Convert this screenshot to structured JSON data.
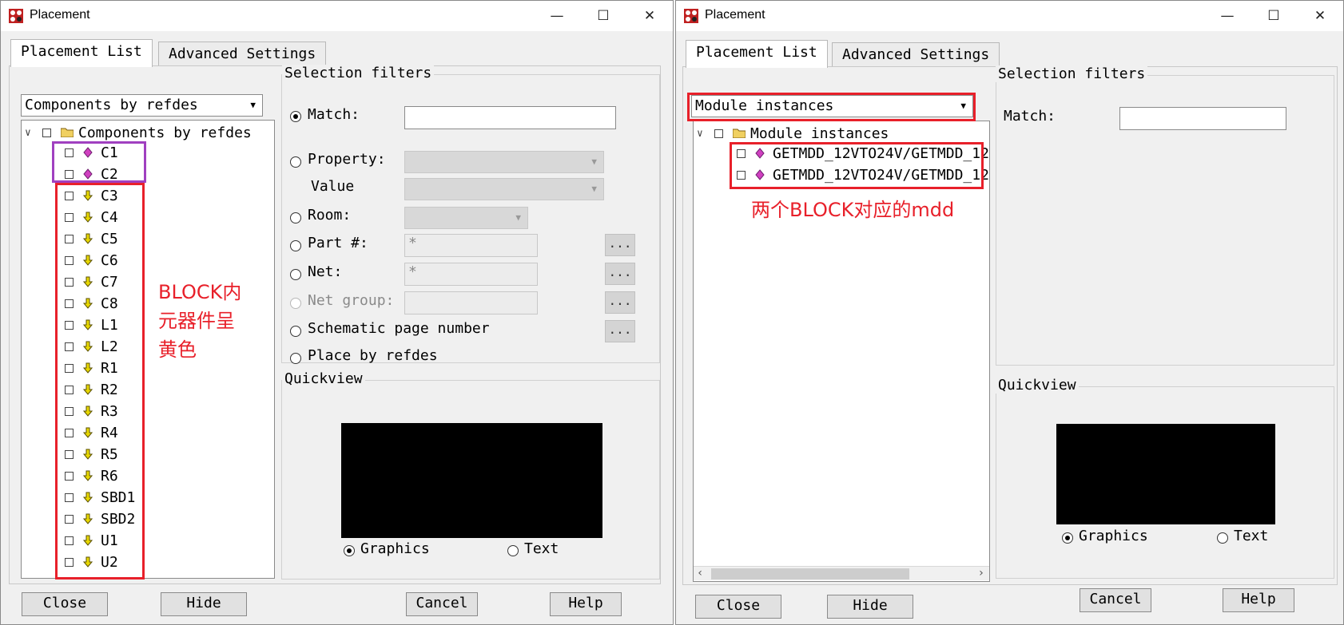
{
  "left_window": {
    "title": "Placement",
    "tabs": [
      {
        "label": "Placement List"
      },
      {
        "label": "Advanced Settings"
      }
    ],
    "dropdown_value": "Components by refdes",
    "tree_root": "Components by refdes",
    "components": [
      "C1",
      "C2",
      "C3",
      "C4",
      "C5",
      "C6",
      "C7",
      "C8",
      "L1",
      "L2",
      "R1",
      "R2",
      "R3",
      "R4",
      "R5",
      "R6",
      "SBD1",
      "SBD2",
      "U1",
      "U2"
    ],
    "selection_filters": {
      "label": "Selection filters",
      "match": "Match:",
      "property": "Property:",
      "value": "Value",
      "room": "Room:",
      "part": "Part #:",
      "part_value": "*",
      "net": "Net:",
      "net_value": "*",
      "net_group": "Net group:",
      "schematic_page": "Schematic page number",
      "place_by_refdes": "Place by refdes",
      "ellipsis": "..."
    },
    "quickview": {
      "label": "Quickview",
      "graphics": "Graphics",
      "text": "Text"
    },
    "buttons": {
      "close": "Close",
      "hide": "Hide",
      "cancel": "Cancel",
      "help": "Help"
    },
    "annotation": [
      "BLOCK内",
      "元器件呈",
      "黄色"
    ]
  },
  "right_window": {
    "title": "Placement",
    "tabs": [
      {
        "label": "Placement List"
      },
      {
        "label": "Advanced Settings"
      }
    ],
    "dropdown_value": "Module instances",
    "tree_root": "Module instances",
    "instances": [
      "GETMDD_12VTO24V/GETMDD_12",
      "GETMDD_12VTO24V/GETMDD_12"
    ],
    "selection_filters": {
      "label": "Selection filters",
      "match": "Match:"
    },
    "quickview": {
      "label": "Quickview",
      "graphics": "Graphics",
      "text": "Text"
    },
    "buttons": {
      "close": "Close",
      "hide": "Hide",
      "cancel": "Cancel",
      "help": "Help"
    },
    "annotation": "两个BLOCK对应的mdd"
  },
  "colors": {
    "annotation_red": "#e8202a",
    "highlight_red": "#e8202a",
    "highlight_purple": "#a040c0",
    "module_icon_magenta": "#d040c0",
    "block_icon_yellow": "#e8d800"
  },
  "icons": {
    "app": "placement-app-icon",
    "minimize": "minimize-icon",
    "maximize": "maximize-icon",
    "close": "close-icon",
    "folder": "folder-open-icon",
    "module_component": "magenta-diamond-icon",
    "block_component": "yellow-arrow-icon"
  }
}
